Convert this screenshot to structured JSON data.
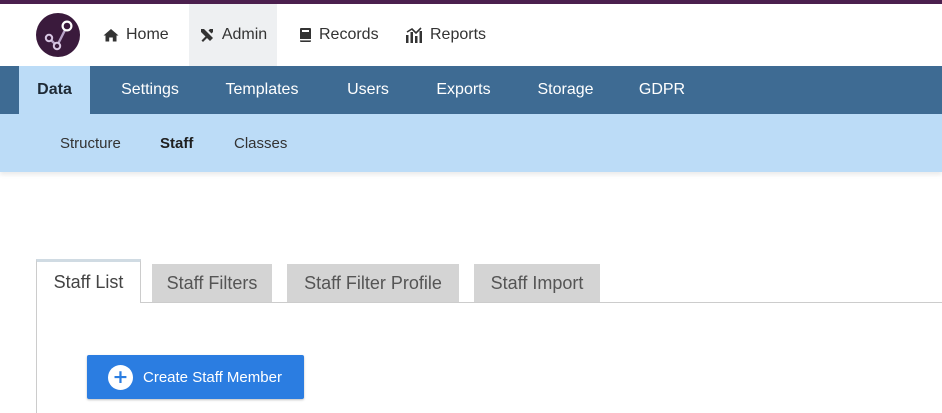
{
  "colors": {
    "top_border": "#4b1f4e",
    "primary_nav_bg": "#3e6b93",
    "sub_nav_bg": "#bcdcf7",
    "button_bg": "#2b7de1",
    "inactive_tab_bg": "#d4d4d4"
  },
  "topnav": {
    "logo_icon": "network-graph-logo",
    "items": [
      {
        "label": "Home",
        "icon": "home-icon"
      },
      {
        "label": "Admin",
        "icon": "tools-icon"
      },
      {
        "label": "Records",
        "icon": "book-icon"
      },
      {
        "label": "Reports",
        "icon": "chart-icon"
      }
    ],
    "active": "Admin"
  },
  "primary_tabs": {
    "items": [
      "Data",
      "Settings",
      "Templates",
      "Users",
      "Exports",
      "Storage",
      "GDPR"
    ],
    "active": "Data"
  },
  "sub_tabs": {
    "items": [
      "Structure",
      "Staff",
      "Classes"
    ],
    "active": "Staff"
  },
  "panel_tabs": {
    "items": [
      "Staff List",
      "Staff Filters",
      "Staff Filter Profile",
      "Staff Import"
    ],
    "active": "Staff List"
  },
  "create_button": {
    "label": "Create Staff Member",
    "icon": "plus-circle-icon"
  }
}
